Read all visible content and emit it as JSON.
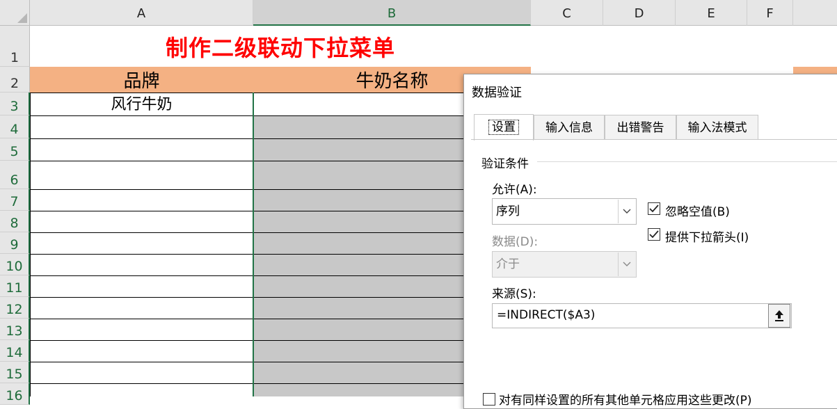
{
  "columns": [
    "A",
    "B",
    "C",
    "D",
    "E",
    "F"
  ],
  "rows": [
    "1",
    "2",
    "3",
    "4",
    "5",
    "6",
    "7",
    "8",
    "9",
    "10",
    "11",
    "12",
    "13",
    "14",
    "15",
    "16"
  ],
  "sheet": {
    "title": "制作二级联动下拉菜单",
    "header_brand": "品牌",
    "header_milk": "牛奶名称",
    "a3": "风行牛奶"
  },
  "colors": {
    "title": "#ff0000",
    "header_fill": "#f4b183",
    "selected_fill": "#c8c8c8",
    "accent": "#217346"
  },
  "dialog": {
    "title": "数据验证",
    "tabs": [
      "设置",
      "输入信息",
      "出错警告",
      "输入法模式"
    ],
    "active_tab": "设置",
    "group_label": "验证条件",
    "allow_label": "允许(A):",
    "allow_value": "序列",
    "data_label": "数据(D):",
    "data_value": "介于",
    "ignore_blank": "忽略空值(B)",
    "dropdown_arrow": "提供下拉箭头(I)",
    "source_label": "来源(S):",
    "source_value": "=INDIRECT($A3)",
    "apply_all": "对有同样设置的所有其他单元格应用这些更改(P)"
  }
}
